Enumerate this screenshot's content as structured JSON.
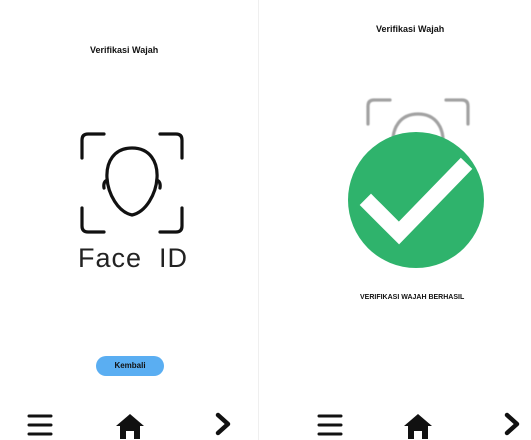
{
  "left_screen": {
    "title": "Verifikasi Wajah",
    "face_id_label": "Face  ID",
    "back_button_label": "Kembali"
  },
  "right_screen": {
    "title": "Verifikasi Wajah",
    "success_message": "VERIFIKASI WAJAH BERHASIL"
  },
  "bottom_nav": {
    "icons": [
      "menu-icon",
      "home-icon",
      "chevron-right-icon"
    ]
  },
  "colors": {
    "success_green": "#2fb36c",
    "button_blue": "#5aaef2"
  }
}
